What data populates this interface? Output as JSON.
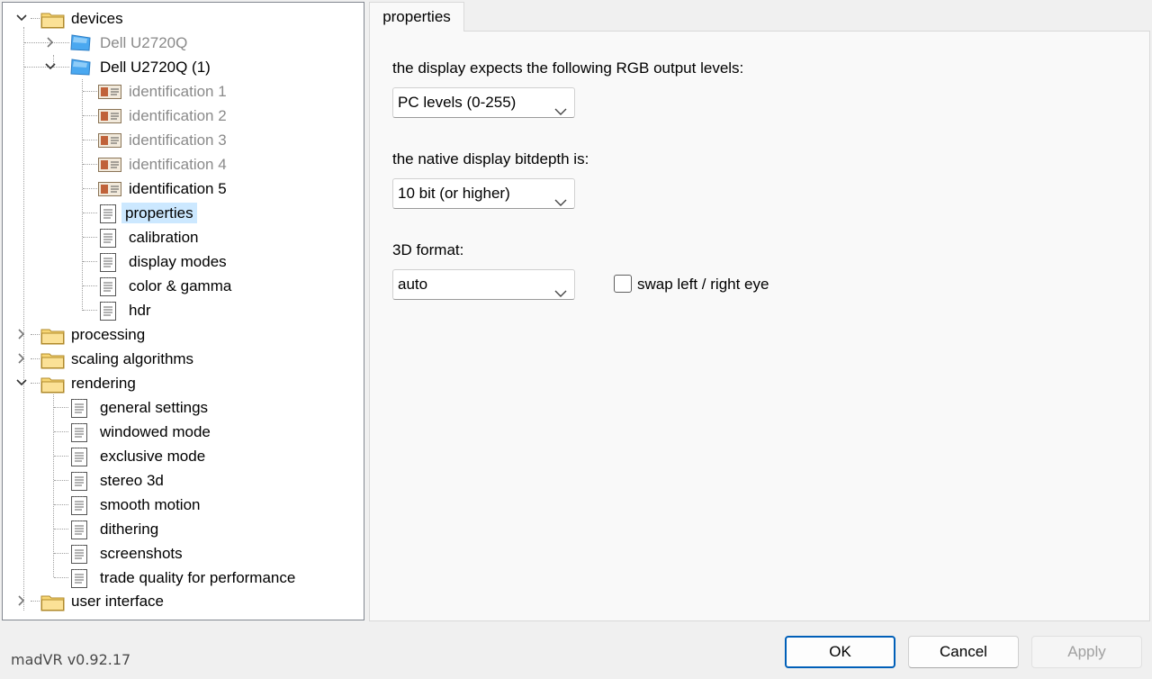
{
  "app": {
    "version": "madVR v0.92.17"
  },
  "tree": {
    "devices": "devices",
    "dev1": "Dell U2720Q",
    "dev2": "Dell U2720Q (1)",
    "dev2_children": [
      "identification 1",
      "identification 2",
      "identification 3",
      "identification 4",
      "identification 5",
      "properties",
      "calibration",
      "display modes",
      "color & gamma",
      "hdr"
    ],
    "processing": "processing",
    "scaling": "scaling algorithms",
    "rendering": "rendering",
    "rendering_children": [
      "general settings",
      "windowed mode",
      "exclusive mode",
      "stereo 3d",
      "smooth motion",
      "dithering",
      "screenshots",
      "trade quality for performance"
    ],
    "ui": "user interface",
    "selected": "properties"
  },
  "tab": {
    "label": "properties"
  },
  "form": {
    "rgb_label": "the display expects the following RGB output levels:",
    "rgb_value": "PC levels (0-255)",
    "bitdepth_label": "the native display bitdepth is:",
    "bitdepth_value": "10 bit (or higher)",
    "format3d_label": "3D format:",
    "format3d_value": "auto",
    "swap_label": "swap left / right eye",
    "swap_checked": false
  },
  "buttons": {
    "ok": "OK",
    "cancel": "Cancel",
    "apply": "Apply"
  },
  "icons": {
    "expand_open": "chevron-down-icon",
    "expand_closed": "chevron-right-icon",
    "folder": "folder-icon",
    "monitor": "monitor-icon",
    "id_card": "id-card-icon",
    "page": "page-icon"
  },
  "colors": {
    "selection": "#cce8ff",
    "folder": "#f8d775",
    "accent": "#005fb8"
  }
}
